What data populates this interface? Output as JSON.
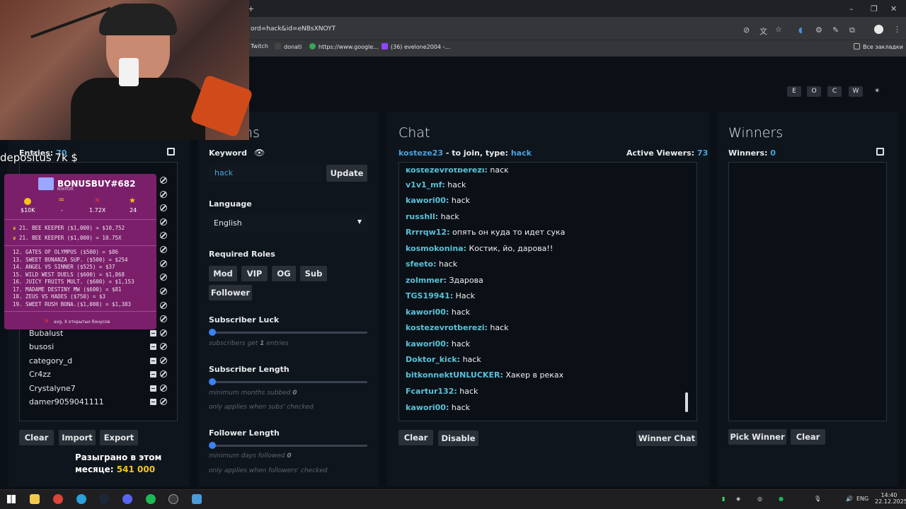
{
  "browser": {
    "address": "ord=hack&id=eNBsXNOYT",
    "new_tab": "+",
    "bookmarks": [
      {
        "label": "Twitch",
        "color": "#9146ff"
      },
      {
        "label": "donati",
        "color": "#444"
      },
      {
        "label": "https://www.google...",
        "color": "#34a853"
      },
      {
        "label": "(36) evelone2004 -...",
        "color": "#9146ff"
      }
    ],
    "all_bookmarks": "Все закладки"
  },
  "overlay": {
    "deposit_text": "depositus 7k $",
    "bonus_title": "BONUSBUY#682",
    "bonus_sub": "KOSTEZE",
    "stats": [
      {
        "icon": "coin-icon",
        "value": "$10K",
        "color": "#f5c518"
      },
      {
        "icon": "wave-icon",
        "value": "-",
        "color": "#f5c518"
      },
      {
        "icon": "x-icon",
        "value": "1.72X",
        "color": "#e53935"
      },
      {
        "icon": "star-icon",
        "value": "24",
        "color": "#f5c518"
      }
    ],
    "best_rows": [
      "21. BEE KEEPER   ($1,000) = $10,752",
      "21. BEE KEEPER   ($1,000) = 10.75X"
    ],
    "list_rows": [
      "12. GATES OF OLYMPUS  ($500) =    $86",
      "13. SWEET BONANZA SUP. ($500) =   $254",
      "14. ANGEL VS SINNER   ($525) =    $37",
      "15. WILD WEST DUELS   ($600) = $1,868",
      "16. JUICY FRUITS MULT. ($600) = $1,153",
      "17. MADAME DESTINY MW  ($600) =    $81",
      "18. ZEUS VS HADES     ($750) =     $3",
      "19. SWEET RUSH BONA.($1,000) = $1,383"
    ],
    "footer": "avg. X открытых бонусов",
    "raffled_line1": "Разыграно в этом",
    "raffled_line2": "месяце:",
    "raffled_amount": "541 000"
  },
  "nav": [
    "E",
    "O",
    "C",
    "W",
    "☀"
  ],
  "entries": {
    "label": "Entries:",
    "count": "70",
    "visible": [
      "Bubalust",
      "busosi",
      "category_d",
      "Cr4zz",
      "Crystalyne7",
      "damer9059041111"
    ],
    "buttons": {
      "clear": "Clear",
      "import": "Import",
      "export": "Export"
    }
  },
  "options": {
    "title_tail": "ns",
    "keyword_label": "Keyword",
    "keyword_value": "hack",
    "update": "Update",
    "language_label": "Language",
    "language_value": "English",
    "roles_label": "Required Roles",
    "roles": [
      "Mod",
      "VIP",
      "OG",
      "Sub",
      "Follower"
    ],
    "sub_luck_label": "Subscriber Luck",
    "sub_luck_hint_pre": "subscribers get ",
    "sub_luck_value": "1",
    "sub_luck_hint_post": " entries",
    "sub_len_label": "Subscriber Length",
    "sub_len_hint_pre": "minimum months subbed ",
    "sub_len_value": "0",
    "sub_len_hint2": "only applies when subs' checked",
    "fol_len_label": "Follower Length",
    "fol_len_hint_pre": "minimum days followed ",
    "fol_len_value": "0",
    "fol_len_hint2": "only applies when followers' checked"
  },
  "chat": {
    "title": "Chat",
    "join_user": "kosteze23",
    "join_text": " - to join, type: ",
    "join_keyword": "hack",
    "viewers_label": "Active Viewers:",
    "viewers": "73",
    "messages": [
      {
        "user": "kostezevrotberezi:",
        "msg": "hack"
      },
      {
        "user": "v1v1_mf:",
        "msg": "hack"
      },
      {
        "user": "kawori00:",
        "msg": "hack"
      },
      {
        "user": "russhll:",
        "msg": "hack"
      },
      {
        "user": "Rrrrqw12:",
        "msg": "опять он куда то идет сука"
      },
      {
        "user": "kosmokonina:",
        "msg": "Костик, йо, дарова!!"
      },
      {
        "user": "sfeeto:",
        "msg": "hack"
      },
      {
        "user": "zolmmer:",
        "msg": "Здарова"
      },
      {
        "user": "TGS19941:",
        "msg": "Hack"
      },
      {
        "user": "kawori00:",
        "msg": "hack"
      },
      {
        "user": "kostezevrotberezi:",
        "msg": "hack"
      },
      {
        "user": "kawori00:",
        "msg": "hack"
      },
      {
        "user": "Doktor_kick:",
        "msg": "hack"
      },
      {
        "user": "bitkonnektUNLUCKER:",
        "msg": "Хакер в реках"
      },
      {
        "user": "Fcartur132:",
        "msg": "hack"
      },
      {
        "user": "kawori00:",
        "msg": "hack"
      }
    ],
    "clear": "Clear",
    "disable": "Disable",
    "winner_chat": "Winner Chat"
  },
  "winners": {
    "title": "Winners",
    "label": "Winners:",
    "count": "0",
    "pick": "Pick Winner",
    "clear": "Clear"
  },
  "taskbar": {
    "lang": "ENG",
    "time": "14:40",
    "date": "22.12.2025"
  }
}
